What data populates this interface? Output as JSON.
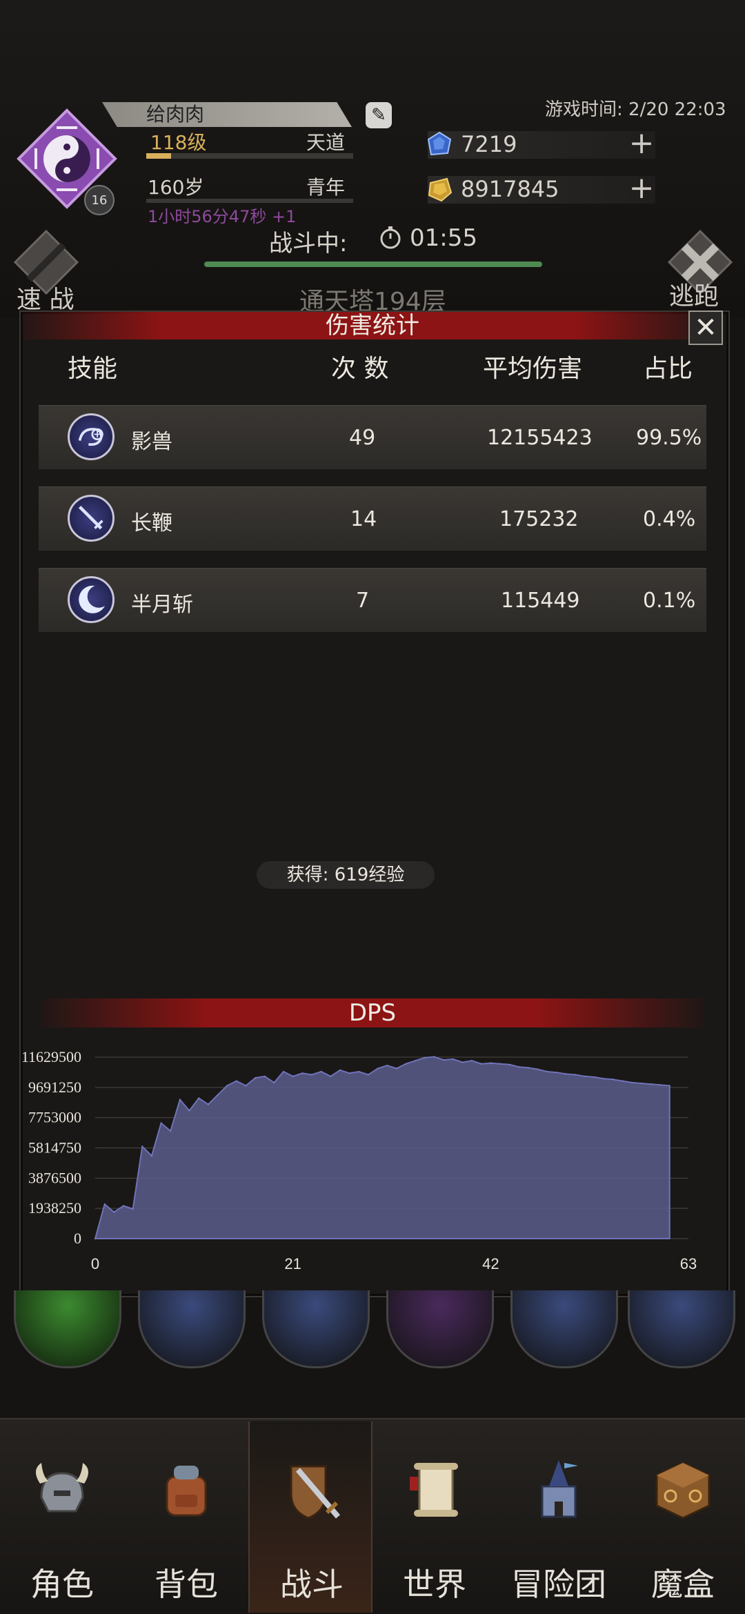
{
  "header": {
    "player_name": "给肉肉",
    "level": "118级",
    "realm": "天道",
    "age": "160岁",
    "life_stage": "青年",
    "timer_text": "1小时56分47秒 +1",
    "avatar_badge": "16",
    "game_time": "游戏时间: 2/20 22:03",
    "gems": "7219",
    "gold": "8917845",
    "battle_status": "战斗中:",
    "battle_timer": "01:55",
    "quick_battle": "速 战",
    "flee": "逃跑",
    "tower": "通天塔194层"
  },
  "modal": {
    "title": "伤害统计",
    "headers": {
      "skill": "技能",
      "count": "次 数",
      "avg": "平均伤害",
      "ratio": "占比"
    },
    "rows": [
      {
        "name": "影兽",
        "count": "49",
        "avg": "12155423",
        "ratio": "99.5%",
        "icon": "shadow-beast-icon"
      },
      {
        "name": "长鞭",
        "count": "14",
        "avg": "175232",
        "ratio": "0.4%",
        "icon": "whip-sword-icon"
      },
      {
        "name": "半月斩",
        "count": "7",
        "avg": "115449",
        "ratio": "0.1%",
        "icon": "crescent-moon-icon"
      }
    ],
    "exp_text": "获得: 619经验",
    "dps_title": "DPS"
  },
  "chart_data": {
    "type": "area",
    "title": "DPS",
    "xlabel": "",
    "ylabel": "",
    "xlim": [
      0,
      63
    ],
    "ylim": [
      0,
      11629500
    ],
    "x_ticks": [
      "0",
      "21",
      "42",
      "63"
    ],
    "y_ticks": [
      "11629500",
      "9691250",
      "7753000",
      "5814750",
      "3876500",
      "1938250",
      "0"
    ],
    "grid": true,
    "color": "#5a5d8c",
    "series": [
      {
        "x": [
          0,
          1,
          2,
          3,
          4,
          5,
          6,
          7,
          8,
          9,
          10,
          11,
          12,
          13,
          14,
          15,
          16,
          17,
          18,
          19,
          20,
          21,
          22,
          23,
          24,
          25,
          26,
          27,
          28,
          29,
          30,
          31,
          32,
          33,
          34,
          35,
          36,
          37,
          38,
          39,
          40,
          41,
          42,
          43,
          44,
          45,
          46,
          47,
          48,
          49,
          50,
          51,
          52,
          53,
          54,
          55,
          56,
          57,
          58,
          59,
          60,
          61
        ],
        "values": [
          0,
          2200000,
          1700000,
          2100000,
          1900000,
          5900000,
          5300000,
          7400000,
          6900000,
          8900000,
          8200000,
          9000000,
          8600000,
          9200000,
          9800000,
          10100000,
          9800000,
          10300000,
          10400000,
          10000000,
          10700000,
          10400000,
          10600000,
          10500000,
          10700000,
          10400000,
          10800000,
          10600000,
          10700000,
          10500000,
          10900000,
          11100000,
          10900000,
          11200000,
          11400000,
          11600000,
          11650000,
          11450000,
          11500000,
          11300000,
          11400000,
          11200000,
          11250000,
          11200000,
          11150000,
          11000000,
          10950000,
          10850000,
          10700000,
          10650000,
          10550000,
          10500000,
          10400000,
          10350000,
          10250000,
          10200000,
          10100000,
          10000000,
          9950000,
          9900000,
          9850000,
          9800000
        ]
      }
    ]
  },
  "nav": [
    {
      "label": "角色",
      "icon": "helmet-icon"
    },
    {
      "label": "背包",
      "icon": "backpack-icon"
    },
    {
      "label": "战斗",
      "icon": "sword-shield-icon"
    },
    {
      "label": "世界",
      "icon": "scroll-icon"
    },
    {
      "label": "冒险团",
      "icon": "castle-icon"
    },
    {
      "label": "魔盒",
      "icon": "magic-box-icon"
    }
  ],
  "colors": {
    "accent_red": "#8c1414",
    "gold": "#d9b15c",
    "purple": "#8e4a9e",
    "hp_green": "#4e8a52"
  }
}
